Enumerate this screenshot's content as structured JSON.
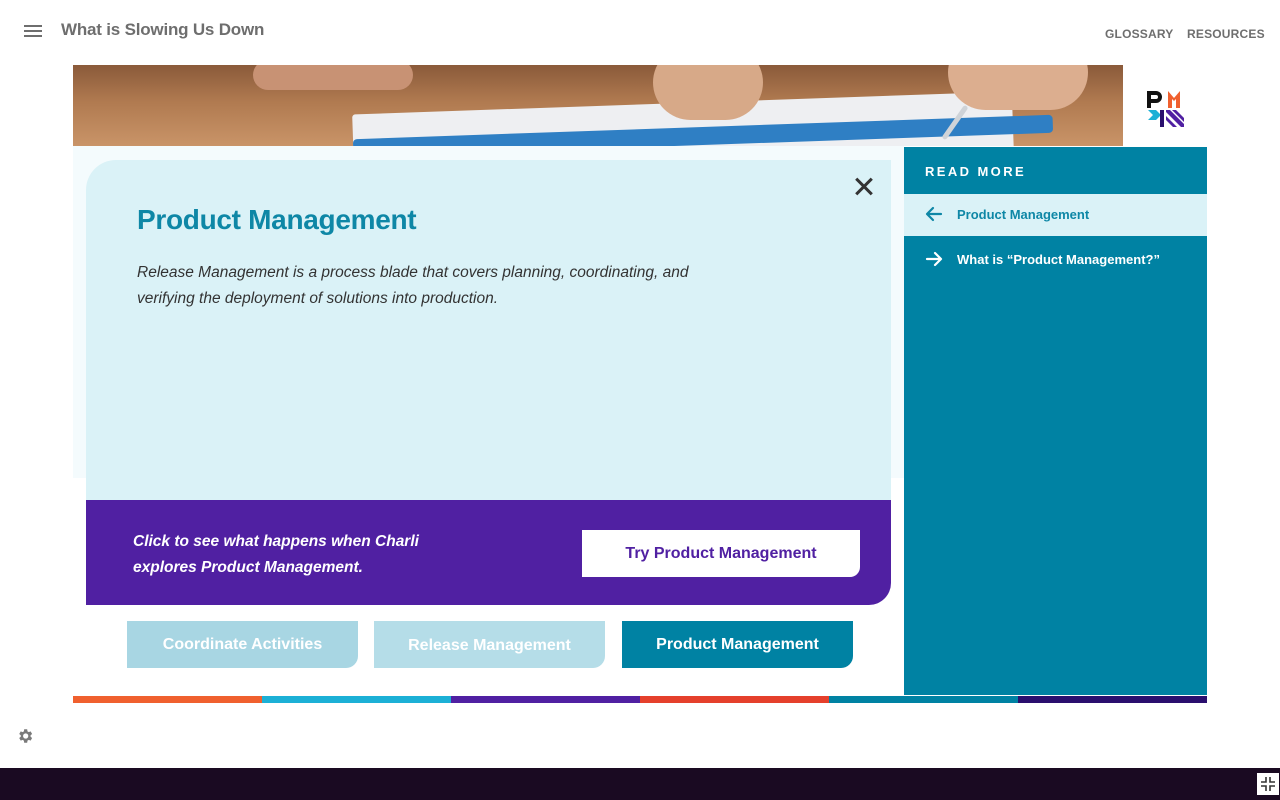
{
  "header": {
    "course_title": "What is Slowing Us Down",
    "nav": [
      "GLOSSARY",
      "RESOURCES"
    ]
  },
  "modal": {
    "title": "Product Management",
    "description": "Release Management is a process blade that covers planning, coordinating, and verifying the deployment of solutions into production.",
    "cta_text": "Click to see what happens when Charli explores Product Management.",
    "cta_button": "Try Product Management"
  },
  "tabs": [
    {
      "label": "Coordinate Activities",
      "state": "inactive"
    },
    {
      "label": "Release Management",
      "state": "inactive"
    },
    {
      "label": "Product Management",
      "state": "active"
    }
  ],
  "sidebar": {
    "header": "READ MORE",
    "items": [
      {
        "label": "Product Management",
        "icon": "arrow-left-icon",
        "active": true
      },
      {
        "label": "What is “Product Management?”",
        "icon": "arrow-right-icon",
        "active": false
      }
    ]
  },
  "progress_strip_colors": [
    "#f0602e",
    "#1cb0d6",
    "#5020a2",
    "#e5402c",
    "#0082a3",
    "#2a0f6e"
  ],
  "colors": {
    "accent_teal": "#0082a3",
    "title_teal": "#0e87a6",
    "cta_purple": "#5020a2",
    "light_panel": "#daf2f7"
  }
}
